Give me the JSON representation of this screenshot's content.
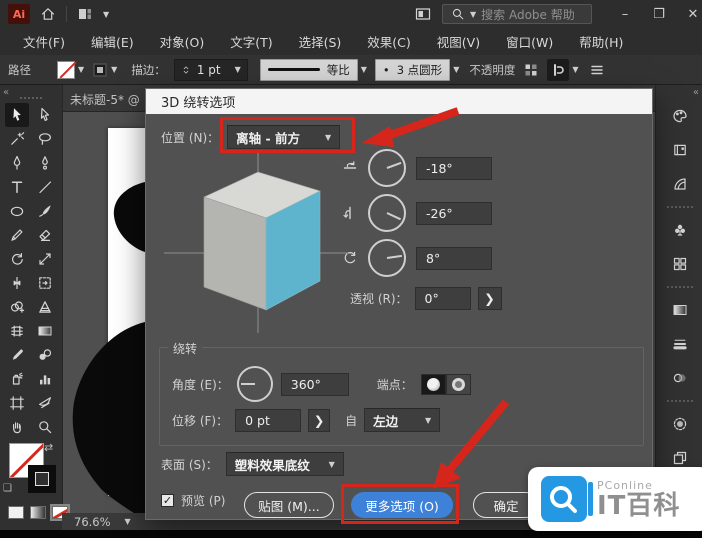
{
  "window": {
    "search_placeholder": "搜索 Adobe 帮助",
    "minimize_glyph": "–",
    "maximize_glyph": "❐",
    "close_glyph": "✕"
  },
  "menubar": {
    "items": [
      "文件(F)",
      "编辑(E)",
      "对象(O)",
      "文字(T)",
      "选择(S)",
      "效果(C)",
      "视图(V)",
      "窗口(W)",
      "帮助(H)"
    ]
  },
  "controlbar": {
    "path_label": "路径",
    "stroke_label": "描边：",
    "stroke_weight": "1 pt",
    "profile_label": "等比",
    "brush_bullet": "•",
    "brush_label": "3 点圆形",
    "opacity_label": "不透明度"
  },
  "tabbar": {
    "active_tab": "未标题-5* @"
  },
  "toolbar": {
    "active_tool": "selection-tool",
    "tools": [
      [
        "selection-tool",
        "direct-selection-tool"
      ],
      [
        "magic-wand-tool",
        "lasso-tool"
      ],
      [
        "pen-tool",
        "curvature-tool"
      ],
      [
        "type-tool",
        "line-segment-tool"
      ],
      [
        "ellipse-tool",
        "paintbrush-tool"
      ],
      [
        "shaper-tool",
        "eraser-tool"
      ],
      [
        "rotate-tool",
        "scale-tool"
      ],
      [
        "width-tool",
        "free-transform-tool"
      ],
      [
        "shape-builder-tool",
        "perspective-grid-tool"
      ],
      [
        "mesh-tool",
        "gradient-tool"
      ],
      [
        "eyedropper-tool",
        "blend-tool"
      ],
      [
        "symbol-sprayer-tool",
        "column-graph-tool"
      ],
      [
        "artboard-tool",
        "slice-tool"
      ],
      [
        "hand-tool",
        "zoom-tool"
      ]
    ]
  },
  "rightpanel": {
    "groups": [
      [
        "color-panel",
        "swatches-panel",
        "brushes-panel"
      ],
      [
        "symbols-panel",
        "pattern-panel"
      ],
      [
        "gradient-panel",
        "stroke-panel",
        "transparency-panel"
      ],
      [
        "appearance-panel",
        "artboards-panel"
      ],
      [
        "layers-panel"
      ]
    ]
  },
  "dialog": {
    "title": "3D 绕转选项",
    "position_label": "位置 (N)：",
    "position_value": "离轴 - 前方",
    "rotations": [
      {
        "axis": "rotate-x-icon",
        "value": "-18°",
        "needle_deg": -20
      },
      {
        "axis": "rotate-y-icon",
        "value": "-26°",
        "needle_deg": 25
      },
      {
        "axis": "rotate-z-icon",
        "value": "8°",
        "needle_deg": -8
      }
    ],
    "perspective_label": "透视 (R)：",
    "perspective_value": "0°",
    "revolve_group": {
      "label": "绕转",
      "angle_label": "角度 (E)：",
      "angle_value": "360°",
      "angle_needle_deg": 180,
      "caps_label": "端点：",
      "offset_label": "位移 (F)：",
      "offset_value": "0 pt",
      "from_label": "自",
      "from_value": "左边"
    },
    "surface_label": "表面 (S)：",
    "surface_value": "塑料效果底纹",
    "preview_label": "预览 (P)",
    "preview_checked": "✓",
    "map_button_label": "贴图 (M)...",
    "more_options_label": "更多选项 (O)",
    "ok_label": "确定"
  },
  "statusbar": {
    "zoom_level": "76.6%"
  },
  "watermark": {
    "brand": "PConline",
    "title": "IT百科"
  },
  "colors": {
    "accent_blue": "#3d82d8",
    "annotation_red": "#d6261c",
    "cube_front": "#5fb4cd",
    "cube_top": "#d8d8d4",
    "cube_left": "#b4b4b0",
    "watermark_blue": "#2598e4"
  }
}
